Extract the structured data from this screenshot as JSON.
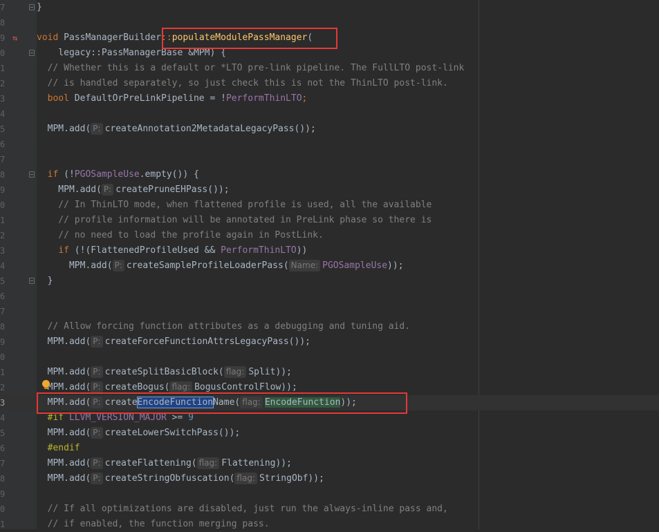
{
  "editor": {
    "lines": [
      {
        "num": "7",
        "segments": [
          {
            "t": "}",
            "c": ""
          }
        ]
      },
      {
        "num": "8",
        "segments": []
      },
      {
        "num": "9",
        "segments": [
          {
            "t": "void ",
            "c": "k"
          },
          {
            "t": "PassManagerBuilder",
            "c": ""
          },
          {
            "t": "::",
            "c": "k"
          },
          {
            "t": "populateModulePassManager",
            "c": "fn"
          },
          {
            "t": "(",
            "c": ""
          }
        ]
      },
      {
        "num": "0",
        "segments": [
          {
            "t": "    legacy::PassManagerBase &MPM) {",
            "c": ""
          }
        ]
      },
      {
        "num": "1",
        "segments": [
          {
            "t": "  // Whether this is a default or *LTO pre-link pipeline. The FullLTO post-link",
            "c": "c"
          }
        ]
      },
      {
        "num": "2",
        "segments": [
          {
            "t": "  // is handled separately, so just check this is not the ThinLTO post-link.",
            "c": "c"
          }
        ]
      },
      {
        "num": "3",
        "segments": [
          {
            "t": "  ",
            "c": ""
          },
          {
            "t": "bool",
            "c": "k"
          },
          {
            "t": " DefaultOrPreLinkPipeline = !",
            "c": ""
          },
          {
            "t": "PerformThinLTO",
            "c": "mg"
          },
          {
            "t": ";",
            "c": "k"
          }
        ]
      },
      {
        "num": "4",
        "segments": []
      },
      {
        "num": "5",
        "segments": [
          {
            "t": "  MPM.add(",
            "c": ""
          },
          {
            "t": "P:",
            "c": "hint"
          },
          {
            "t": "createAnnotation2MetadataLegacyPass());",
            "c": ""
          }
        ]
      },
      {
        "num": "6",
        "segments": []
      },
      {
        "num": "7",
        "segments": []
      },
      {
        "num": "8",
        "segments": [
          {
            "t": "  ",
            "c": ""
          },
          {
            "t": "if",
            "c": "k"
          },
          {
            "t": " (!",
            "c": ""
          },
          {
            "t": "PGOSampleUse",
            "c": "mg"
          },
          {
            "t": ".empty()) {",
            "c": ""
          }
        ]
      },
      {
        "num": "9",
        "segments": [
          {
            "t": "    MPM.add(",
            "c": ""
          },
          {
            "t": "P:",
            "c": "hint"
          },
          {
            "t": "createPruneEHPass());",
            "c": ""
          }
        ]
      },
      {
        "num": "0",
        "segments": [
          {
            "t": "    // In ThinLTO mode, when flattened profile is used, all the available",
            "c": "c"
          }
        ]
      },
      {
        "num": "1",
        "segments": [
          {
            "t": "    // profile information will be annotated in PreLink phase so there is",
            "c": "c"
          }
        ]
      },
      {
        "num": "2",
        "segments": [
          {
            "t": "    // no need to load the profile again in PostLink.",
            "c": "c"
          }
        ]
      },
      {
        "num": "3",
        "segments": [
          {
            "t": "    ",
            "c": ""
          },
          {
            "t": "if",
            "c": "k"
          },
          {
            "t": " (!(",
            "c": ""
          },
          {
            "t": "FlattenedProfileUsed",
            "c": ""
          },
          {
            "t": " && ",
            "c": ""
          },
          {
            "t": "PerformThinLTO",
            "c": "mg"
          },
          {
            "t": "))",
            "c": ""
          }
        ]
      },
      {
        "num": "4",
        "segments": [
          {
            "t": "      MPM.add(",
            "c": ""
          },
          {
            "t": "P:",
            "c": "hint"
          },
          {
            "t": "createSampleProfileLoaderPass(",
            "c": ""
          },
          {
            "t": "Name:",
            "c": "hint"
          },
          {
            "t": "PGOSampleUse",
            "c": "mg"
          },
          {
            "t": "));",
            "c": ""
          }
        ]
      },
      {
        "num": "5",
        "segments": [
          {
            "t": "  }",
            "c": ""
          }
        ]
      },
      {
        "num": "6",
        "segments": []
      },
      {
        "num": "7",
        "segments": []
      },
      {
        "num": "8",
        "segments": [
          {
            "t": "  // Allow forcing function attributes as a debugging and tuning aid.",
            "c": "c"
          }
        ]
      },
      {
        "num": "9",
        "segments": [
          {
            "t": "  MPM.add(",
            "c": ""
          },
          {
            "t": "P:",
            "c": "hint"
          },
          {
            "t": "createForceFunctionAttrsLegacyPass());",
            "c": ""
          }
        ]
      },
      {
        "num": "0",
        "segments": []
      },
      {
        "num": "1",
        "segments": [
          {
            "t": "  MPM.add(",
            "c": ""
          },
          {
            "t": "P:",
            "c": "hint"
          },
          {
            "t": "createSplitBasicBlock(",
            "c": ""
          },
          {
            "t": "flag:",
            "c": "hint"
          },
          {
            "t": "Split));",
            "c": ""
          }
        ]
      },
      {
        "num": "2",
        "segments": [
          {
            "t": "  MPM.add(",
            "c": ""
          },
          {
            "t": "P:",
            "c": "hint"
          },
          {
            "t": "createBogus(",
            "c": ""
          },
          {
            "t": "flag:",
            "c": "hint"
          },
          {
            "t": "BogusControlFlow));",
            "c": ""
          }
        ]
      },
      {
        "num": "3",
        "segments": [
          {
            "t": "  MPM.add(",
            "c": ""
          },
          {
            "t": "P:",
            "c": "hint"
          },
          {
            "t": "create",
            "c": ""
          },
          {
            "t": "EncodeFunction",
            "c": "sel"
          },
          {
            "t": "Name(",
            "c": ""
          },
          {
            "t": "flag:",
            "c": "hint"
          },
          {
            "t": "EncodeFunction",
            "c": "match"
          },
          {
            "t": "));",
            "c": ""
          }
        ]
      },
      {
        "num": "4",
        "segments": [
          {
            "t": "  ",
            "c": ""
          },
          {
            "t": "#if ",
            "c": "pp"
          },
          {
            "t": "LLVM_VERSION_MAJOR",
            "c": "mg"
          },
          {
            "t": " >= ",
            "c": ""
          },
          {
            "t": "9",
            "c": "n"
          }
        ]
      },
      {
        "num": "5",
        "segments": [
          {
            "t": "  MPM.add(",
            "c": ""
          },
          {
            "t": "P:",
            "c": "hint"
          },
          {
            "t": "createLowerSwitchPass());",
            "c": ""
          }
        ]
      },
      {
        "num": "6",
        "segments": [
          {
            "t": "  ",
            "c": ""
          },
          {
            "t": "#endif",
            "c": "pp"
          }
        ]
      },
      {
        "num": "7",
        "segments": [
          {
            "t": "  MPM.add(",
            "c": ""
          },
          {
            "t": "P:",
            "c": "hint"
          },
          {
            "t": "createFlattening(",
            "c": ""
          },
          {
            "t": "flag:",
            "c": "hint"
          },
          {
            "t": "Flattening));",
            "c": ""
          }
        ]
      },
      {
        "num": "8",
        "segments": [
          {
            "t": "  MPM.add(",
            "c": ""
          },
          {
            "t": "P:",
            "c": "hint"
          },
          {
            "t": "createStringObfuscation(",
            "c": ""
          },
          {
            "t": "flag:",
            "c": "hint"
          },
          {
            "t": "StringObf));",
            "c": ""
          }
        ]
      },
      {
        "num": "9",
        "segments": []
      },
      {
        "num": "0",
        "segments": [
          {
            "t": "  // If all optimizations are disabled, just run the always-inline pass and,",
            "c": "c"
          }
        ]
      },
      {
        "num": "1",
        "segments": [
          {
            "t": "  // if enabled, the function merging pass.",
            "c": "c"
          }
        ]
      }
    ]
  }
}
